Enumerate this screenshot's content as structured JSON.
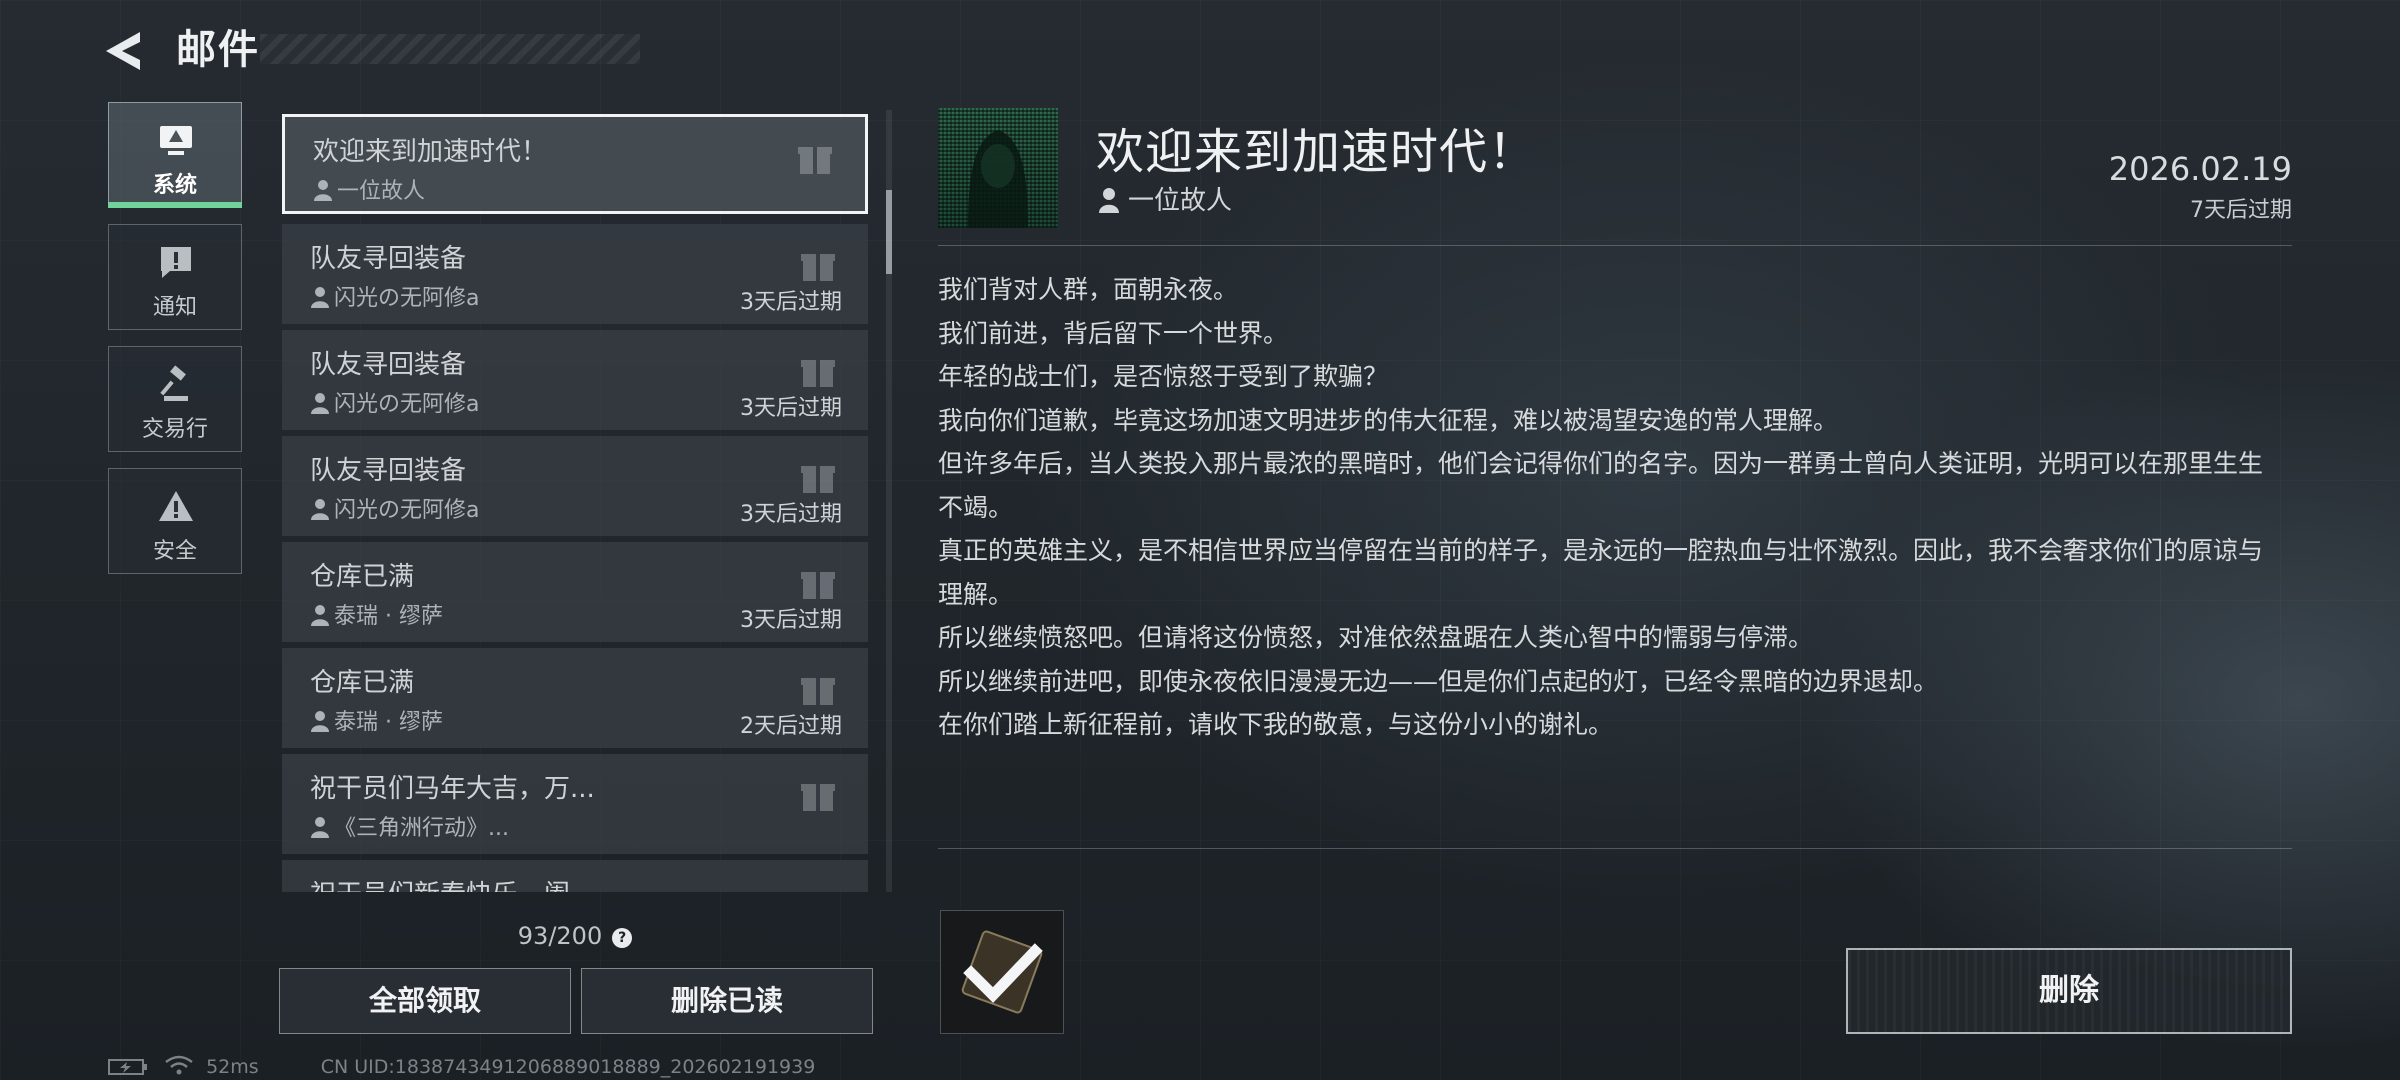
{
  "header": {
    "title": "邮件"
  },
  "categories": [
    {
      "label": "系统",
      "icon": "monitor-icon",
      "active": true
    },
    {
      "label": "通知",
      "icon": "alert-message-icon",
      "active": false
    },
    {
      "label": "交易行",
      "icon": "gavel-icon",
      "active": false
    },
    {
      "label": "安全",
      "icon": "warning-triangle-icon",
      "active": false
    }
  ],
  "mail_list": [
    {
      "subject": "欢迎来到加速时代！",
      "sender": "一位故人",
      "expiry": "",
      "selected": true
    },
    {
      "subject": "队友寻回装备",
      "sender": "闪光の无阿修a",
      "expiry": "3天后过期"
    },
    {
      "subject": "队友寻回装备",
      "sender": "闪光の无阿修a",
      "expiry": "3天后过期"
    },
    {
      "subject": "队友寻回装备",
      "sender": "闪光の无阿修a",
      "expiry": "3天后过期"
    },
    {
      "subject": "仓库已满",
      "sender": "泰瑞 · 缪萨",
      "expiry": "3天后过期"
    },
    {
      "subject": "仓库已满",
      "sender": "泰瑞 · 缪萨",
      "expiry": "2天后过期"
    },
    {
      "subject": "祝干员们马年大吉，万...",
      "sender": "《三角洲行动》...",
      "expiry": ""
    },
    {
      "subject": "祝干员们新春快乐，阖...",
      "sender": "",
      "expiry": ""
    }
  ],
  "mailbox": {
    "count": "93/200",
    "help_label": "?",
    "claim_all_label": "全部领取",
    "delete_read_label": "删除已读"
  },
  "status_bar": {
    "ping": "52ms",
    "uid": "CN UID:1838743491206889018889_202602191939"
  },
  "detail": {
    "title": "欢迎来到加速时代！",
    "sender": "一位故人",
    "date": "2026.02.19",
    "expiry": "7天后过期",
    "body": [
      "我们背对人群，面朝永夜。",
      "我们前进，背后留下一个世界。",
      "年轻的战士们，是否惊怒于受到了欺骗？",
      "我向你们道歉，毕竟这场加速文明进步的伟大征程，难以被渴望安逸的常人理解。",
      "但许多年后，当人类投入那片最浓的黑暗时，他们会记得你们的名字。因为一群勇士曾向人类证明，光明可以在那里生生不竭。",
      "真正的英雄主义，是不相信世界应当停留在当前的样子，是永远的一腔热血与壮怀激烈。因此，我不会奢求你们的原谅与理解。",
      "所以继续愤怒吧。但请将这份愤怒，对准依然盘踞在人类心智中的懦弱与停滞。",
      "所以继续前进吧，即使永夜依旧漫漫无边——但是你们点起的灯，已经令黑暗的边界退却。",
      "在你们踏上新征程前，请收下我的敬意，与这份小小的谢礼。"
    ],
    "delete_label": "删除"
  },
  "colors": {
    "accent_green": "#6fd39a",
    "selected_border": "#f2f4f5"
  }
}
